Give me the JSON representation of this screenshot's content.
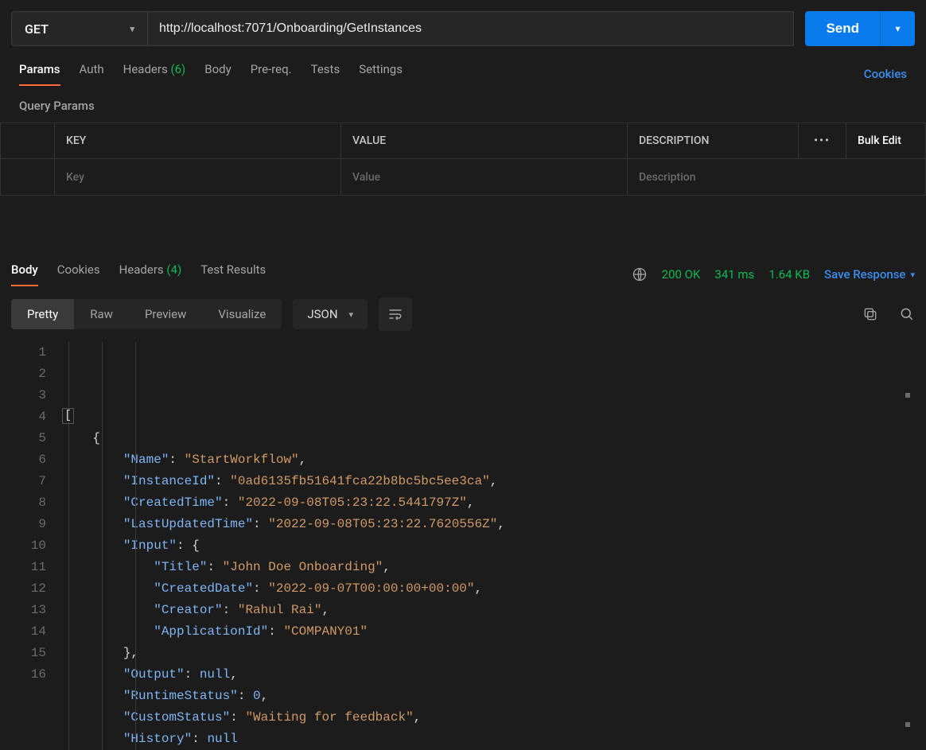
{
  "request": {
    "method": "GET",
    "url": "http://localhost:7071/Onboarding/GetInstances",
    "send_label": "Send",
    "tabs": {
      "params": "Params",
      "auth": "Auth",
      "headers": "Headers",
      "headers_count": "(6)",
      "body": "Body",
      "prereq": "Pre-req.",
      "tests": "Tests",
      "settings": "Settings"
    },
    "cookies_link": "Cookies",
    "sub_title": "Query Params",
    "columns": {
      "key": "KEY",
      "value": "VALUE",
      "description": "DESCRIPTION",
      "bulk": "Bulk Edit"
    },
    "placeholders": {
      "key": "Key",
      "value": "Value",
      "description": "Description"
    }
  },
  "response": {
    "tabs": {
      "body": "Body",
      "cookies": "Cookies",
      "headers": "Headers",
      "headers_count": "(4)",
      "test_results": "Test Results"
    },
    "status": "200 OK",
    "time": "341 ms",
    "size": "1.64 KB",
    "save_label": "Save Response",
    "view_tabs": {
      "pretty": "Pretty",
      "raw": "Raw",
      "preview": "Preview",
      "visualize": "Visualize"
    },
    "format": "JSON",
    "body_json": {
      "Name": "StartWorkflow",
      "InstanceId": "0ad6135fb51641fca22b8bc5bc5ee3ca",
      "CreatedTime": "2022-09-08T05:23:22.5441797Z",
      "LastUpdatedTime": "2022-09-08T05:23:22.7620556Z",
      "Input": {
        "Title": "John Doe Onboarding",
        "CreatedDate": "2022-09-07T00:00:00+00:00",
        "Creator": "Rahul Rai",
        "ApplicationId": "COMPANY01"
      },
      "Output": null,
      "RuntimeStatus": 0,
      "CustomStatus": "Waiting for feedback",
      "History": null
    }
  }
}
